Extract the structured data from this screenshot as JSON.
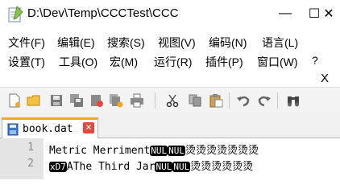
{
  "window": {
    "title": "D:\\Dev\\Temp\\CCCTest\\CCC",
    "minimize_glyph": "—",
    "maximize_glyph": "☐",
    "close_glyph": "✕"
  },
  "menu": {
    "row1": [
      "文件(F)",
      "编辑(E)",
      "搜索(S)",
      "视图(V)",
      "编码(N)",
      "语言(L)"
    ],
    "row2": [
      "设置(T)",
      "工具(O)",
      "宏(M)",
      "运行(R)",
      "插件(P)",
      "窗口(W)",
      "?"
    ]
  },
  "doc_close_glyph": "X",
  "toolbar": {
    "icons": [
      "new-file-icon",
      "open-file-icon",
      "save-icon",
      "save-all-icon",
      "close-icon",
      "close-all-icon",
      "print-icon",
      "cut-icon",
      "copy-icon",
      "paste-icon",
      "undo-icon",
      "redo-icon",
      "find-icon"
    ]
  },
  "tab": {
    "label": "book.dat",
    "close_glyph": "✕"
  },
  "editor": {
    "line_numbers": [
      "1",
      "2"
    ],
    "line1": {
      "text": "Metric Merriment",
      "ctl1": "NUL",
      "ctl2": "NUL",
      "tail": "烫烫烫烫烫烫烫"
    },
    "line2": {
      "ctl0": "xD7",
      "text": "AThe Third Jar",
      "ctl1": "NUL",
      "ctl2": "NUL",
      "tail": "烫烫烫烫烫烫"
    }
  }
}
